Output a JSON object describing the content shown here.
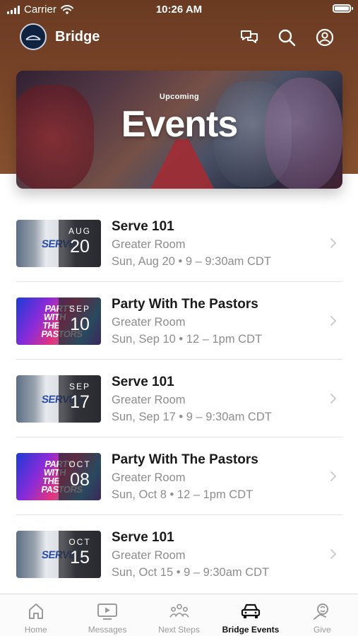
{
  "status_bar": {
    "carrier": "Carrier",
    "time": "10:26 AM"
  },
  "header": {
    "app_name": "Bridge",
    "icons": [
      "chat-icon",
      "search-icon",
      "profile-icon"
    ]
  },
  "hero": {
    "kicker": "Upcoming",
    "title": "Events"
  },
  "events": [
    {
      "title": "Serve 101",
      "location": "Greater Room",
      "time": "Sun, Aug 20 • 9 – 9:30am CDT",
      "month": "AUG",
      "day": "20",
      "thumb": "serve",
      "thumb_text": "SERVE"
    },
    {
      "title": "Party With The Pastors",
      "location": "Greater Room",
      "time": "Sun, Sep 10 • 12 – 1pm CDT",
      "month": "SEP",
      "day": "10",
      "thumb": "party",
      "thumb_text": "PARTY WITH THE PASTORS"
    },
    {
      "title": "Serve 101",
      "location": "Greater Room",
      "time": "Sun, Sep 17 • 9 – 9:30am CDT",
      "month": "SEP",
      "day": "17",
      "thumb": "serve",
      "thumb_text": "SERVE 1"
    },
    {
      "title": "Party With The Pastors",
      "location": "Greater Room",
      "time": "Sun, Oct 8 • 12 – 1pm CDT",
      "month": "OCT",
      "day": "08",
      "thumb": "party",
      "thumb_text": "PARTY WITH THE PASTORS"
    },
    {
      "title": "Serve 101",
      "location": "Greater Room",
      "time": "Sun, Oct 15 • 9 – 9:30am CDT",
      "month": "OCT",
      "day": "15",
      "thumb": "serve",
      "thumb_text": "SERVE 1"
    }
  ],
  "tabs": [
    {
      "label": "Home",
      "icon": "home-icon",
      "active": false
    },
    {
      "label": "Messages",
      "icon": "video-icon",
      "active": false
    },
    {
      "label": "Next Steps",
      "icon": "people-icon",
      "active": false
    },
    {
      "label": "Bridge Events",
      "icon": "car-icon",
      "active": true
    },
    {
      "label": "Give",
      "icon": "give-icon",
      "active": false
    }
  ],
  "colors": {
    "header_brown": "#6a3a22",
    "active_tab": "#111111",
    "inactive_tab": "#9a9a9a",
    "muted_text": "#8d8d8d"
  }
}
